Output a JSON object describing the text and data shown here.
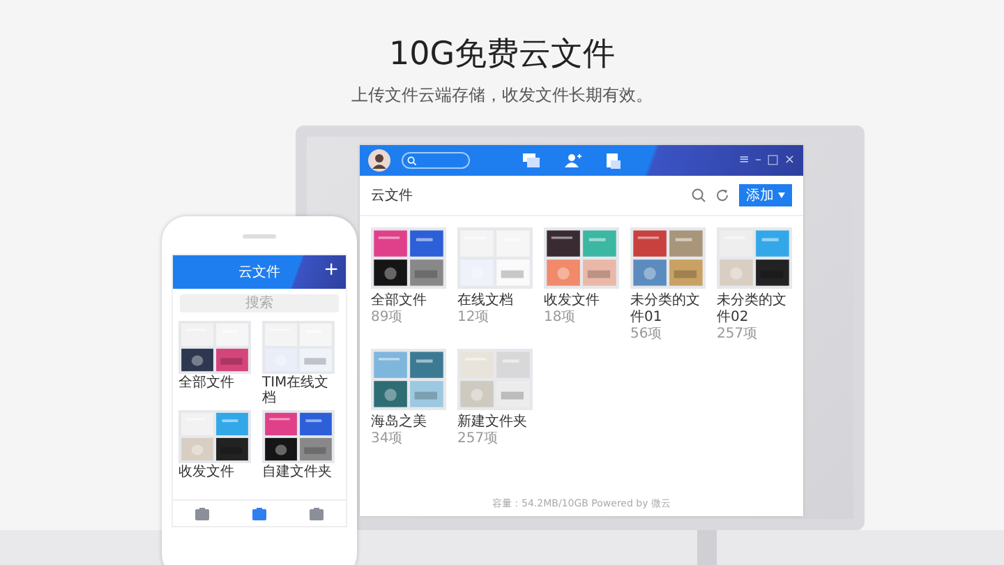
{
  "header": {
    "title": "10G免费云文件",
    "subtitle": "上传文件云端存储，收发文件长期有效。"
  },
  "desktop_app": {
    "window_controls": [
      "≡",
      "–",
      "□",
      "×"
    ],
    "title": "云文件",
    "add_button": "添加",
    "folders": [
      {
        "name": "全部文件",
        "count": "89项"
      },
      {
        "name": "在线文档",
        "count": "12项"
      },
      {
        "name": "收发文件",
        "count": "18项"
      },
      {
        "name": "未分类的文件01",
        "count": "56项"
      },
      {
        "name": "未分类的文件02",
        "count": "257项"
      },
      {
        "name": "海岛之美",
        "count": "34项"
      },
      {
        "name": "新建文件夹",
        "count": "257项"
      }
    ],
    "footer": "容量：54.2MB/10GB   Powered by 微云"
  },
  "phone_app": {
    "title": "云文件",
    "add": "+",
    "search_placeholder": "搜索",
    "folders": [
      {
        "name": "全部文件"
      },
      {
        "name": "TIM在线文档"
      },
      {
        "name": "收发文件"
      },
      {
        "name": "自建文件夹"
      }
    ],
    "tab_bar": [
      {
        "selected": false
      },
      {
        "selected": true
      },
      {
        "selected": false
      }
    ]
  }
}
